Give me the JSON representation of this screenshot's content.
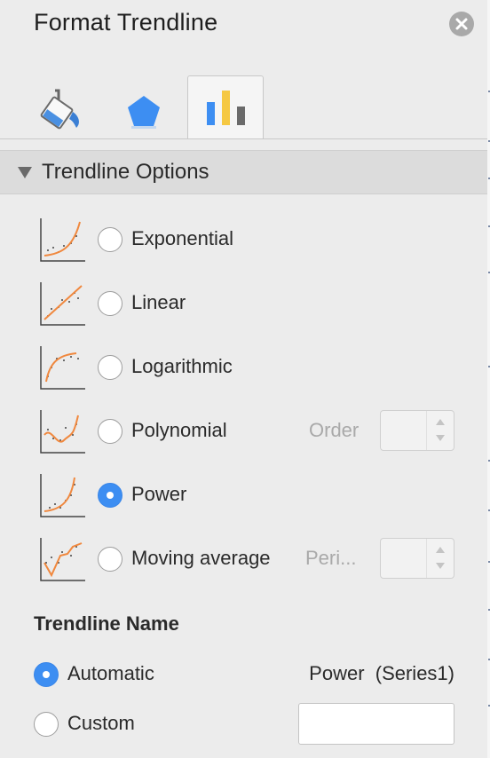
{
  "pane": {
    "title": "Format Trendline",
    "close_icon": "close-circle-icon"
  },
  "tabs": [
    {
      "name": "Fill & Line",
      "icon": "paint-bucket-icon",
      "active": false
    },
    {
      "name": "Effects",
      "icon": "pentagon-icon",
      "active": false
    },
    {
      "name": "Trendline Options",
      "icon": "bar-chart-icon",
      "active": true
    }
  ],
  "section": {
    "label": "Trendline Options",
    "expanded": true
  },
  "trend_types": [
    {
      "label": "Exponential",
      "icon": "exponential-trend-icon",
      "selected": false
    },
    {
      "label": "Linear",
      "icon": "linear-trend-icon",
      "selected": false
    },
    {
      "label": "Logarithmic",
      "icon": "logarithmic-trend-icon",
      "selected": false
    },
    {
      "label": "Polynomial",
      "icon": "polynomial-trend-icon",
      "selected": false,
      "sub_label": "Order",
      "stepper_value": ""
    },
    {
      "label": "Power",
      "icon": "power-trend-icon",
      "selected": true
    },
    {
      "label": "Moving average",
      "icon": "moving-average-trend-icon",
      "selected": false,
      "sub_label": "Peri...",
      "stepper_value": ""
    }
  ],
  "trendline_name": {
    "heading": "Trendline Name",
    "automatic_label": "Automatic",
    "automatic_value": "Power  (Series1)",
    "custom_label": "Custom",
    "custom_value": "",
    "selected": "automatic"
  },
  "colors": {
    "accent": "#3d8ef2",
    "trend_line": "#f0883e",
    "background": "#ececec"
  }
}
